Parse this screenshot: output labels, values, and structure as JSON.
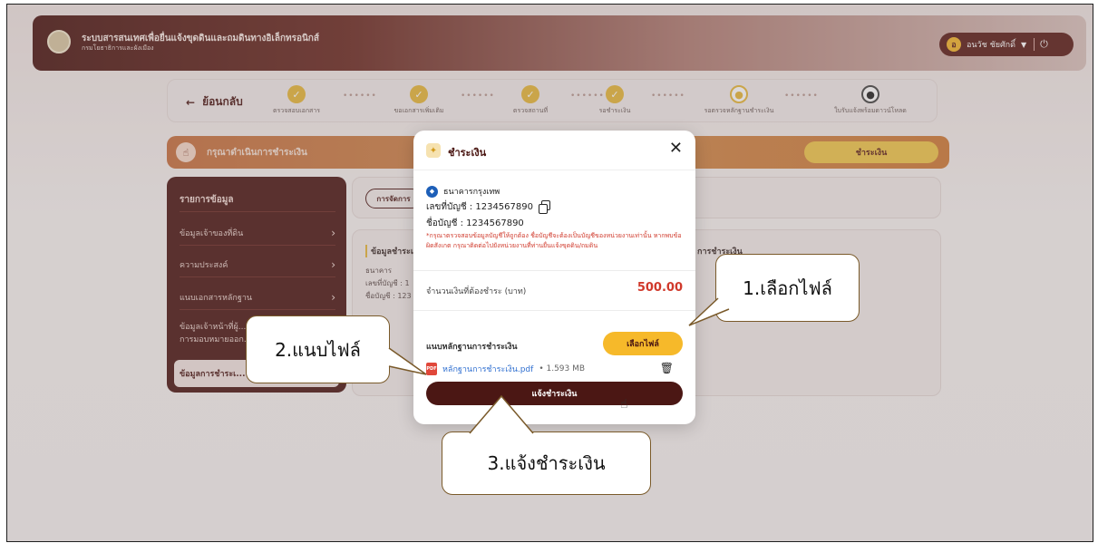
{
  "header": {
    "title": "ระบบสารสนเทศเพื่อยื่นแจ้งขุดดินและถมดินทางอิเล็กทรอนิกส์",
    "subtitle": "กรมโยธาธิการและผังเมือง",
    "user_initial": "อ",
    "user_name": "อนวัช ชัยศักดิ์"
  },
  "stepper": {
    "back_label": "ย้อนกลับ",
    "steps": [
      {
        "label": "ตรวจสอบเอกสาร",
        "state": "done"
      },
      {
        "label": "ขอเอกสารเพิ่มเติม",
        "state": "done"
      },
      {
        "label": "ตรวจสถานที่",
        "state": "done"
      },
      {
        "label": "รอชำระเงิน",
        "state": "done"
      },
      {
        "label": "รอตรวจหลักฐานชำระเงิน",
        "state": "current"
      },
      {
        "label": "ใบรับแจ้งพร้อมดาวน์โหลด",
        "state": "todo"
      }
    ]
  },
  "notice": {
    "text": "กรุณาดำเนินการชำระเงิน",
    "pay_button": "ชำระเงิน"
  },
  "menu": {
    "heading": "รายการข้อมูล",
    "items": [
      {
        "label": "ข้อมูลเจ้าของที่ดิน"
      },
      {
        "label": "ความประสงค์"
      },
      {
        "label": "แนบเอกสารหลักฐาน"
      },
      {
        "label": "ข้อมูลเจ้าหน้าที่ผู้..."
      },
      {
        "label": "การมอบหมายออก..."
      },
      {
        "label": "ข้อมูลการชำระเ..."
      }
    ]
  },
  "content": {
    "tab": "การจัดการ",
    "left_heading": "ข้อมูลชำระเ",
    "right_heading": "การชำระเงิน",
    "bank_short": "ธนาคาร",
    "acc_short": "เลขที่บัญชี : 1",
    "name_short": "ชื่อบัญชี : 123"
  },
  "modal": {
    "title": "ชำระเงิน",
    "close": "✕",
    "bank_name": "ธนาคารกรุงเทพ",
    "account_no": "เลขที่บัญชี : 1234567890",
    "account_name": "ชื่อบัญชี : 1234567890",
    "warning": "*กรุณาตรวจสอบข้อมูลบัญชีให้ถูกต้อง ชื่อบัญชีจะต้องเป็นบัญชีของหน่วยงานเท่านั้น หากพบข้อผิดสังเกต กรุณาติดต่อไปยังหน่วยงานที่ท่านยื่นแจ้งขุดดิน/ถมดิน",
    "amount_label": "จำนวนเงินที่ต้องชำระ (บาท)",
    "amount_value": "500.00",
    "proof_label": "แนบหลักฐานการชำระเงิน",
    "choose_button": "เลือกไฟล์",
    "file_name": "หลักฐานการชำระเงิน.pdf",
    "file_size": "• 1.593 MB",
    "submit_button": "แจ้งชำระเงิน"
  },
  "callouts": {
    "c1": "1.เลือกไฟล์",
    "c2": "2.แนบไฟล์",
    "c3": "3.แจ้งชำระเงิน"
  },
  "colors": {
    "brand": "#4b1714",
    "accent": "#f6b92a",
    "danger": "#d0392b"
  }
}
